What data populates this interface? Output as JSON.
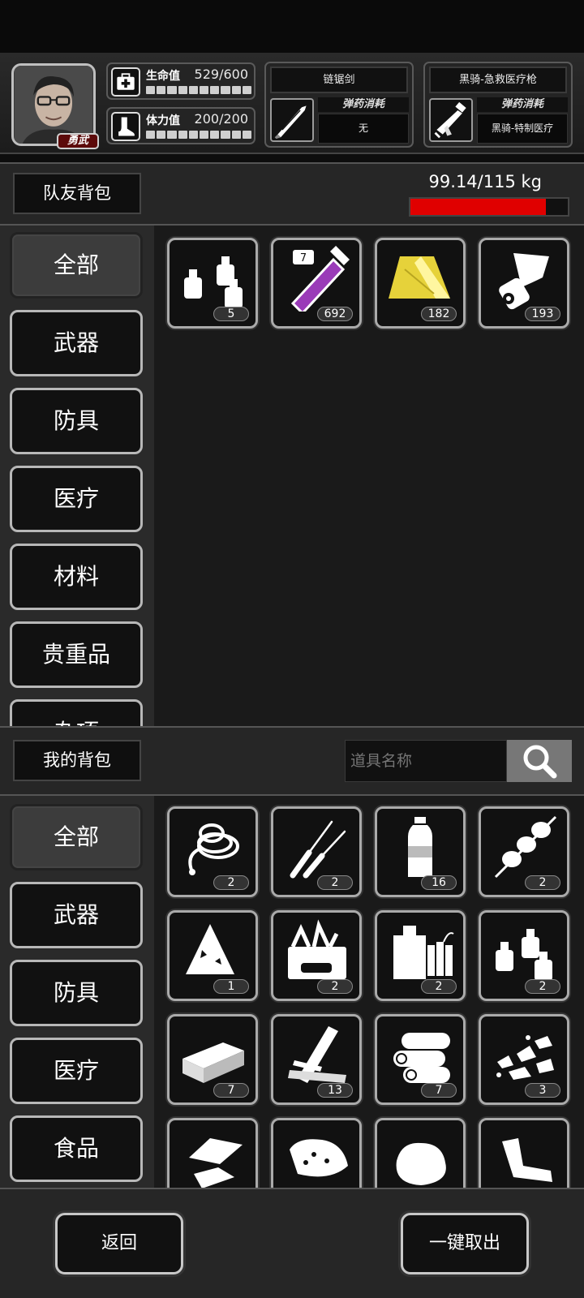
{
  "character": {
    "badge": "勇武"
  },
  "stats": {
    "hp": {
      "label": "生命值",
      "value": "529/600",
      "icon": "first-aid-kit-icon"
    },
    "stamina": {
      "label": "体力值",
      "value": "200/200",
      "icon": "boot-icon"
    }
  },
  "equipment": [
    {
      "name": "链锯剑",
      "ammo_label": "弹药消耗",
      "ammo_value": "无",
      "icon": "chainsaw-sword-icon"
    },
    {
      "name": "黑骑-急救医疗枪",
      "ammo_label": "弹药消耗",
      "ammo_value": "黑骑-特制医疗",
      "icon": "medic-gun-icon"
    }
  ],
  "team_bag": {
    "title": "队友背包",
    "weight": "99.14/115 kg",
    "weight_fraction": 0.862,
    "weight_color": "#e00000",
    "categories": [
      "全部",
      "武器",
      "防具",
      "医疗",
      "材料",
      "贵重品",
      "杂项"
    ],
    "items": [
      {
        "icon": "bottles-icon",
        "count": "5"
      },
      {
        "icon": "serum-vial-icon",
        "count": "692"
      },
      {
        "icon": "cloth-icon",
        "count": "182"
      },
      {
        "icon": "paper-roll-icon",
        "count": "193"
      }
    ]
  },
  "my_bag": {
    "title": "我的背包",
    "search_placeholder": "道具名称",
    "categories": [
      "全部",
      "武器",
      "防具",
      "医疗",
      "食品"
    ],
    "items": [
      {
        "icon": "rope-icon",
        "count": "2"
      },
      {
        "icon": "lockpicks-icon",
        "count": "2"
      },
      {
        "icon": "water-bottle-icon",
        "count": "16"
      },
      {
        "icon": "meat-skewer-icon",
        "count": "2"
      },
      {
        "icon": "rag-icon",
        "count": "1"
      },
      {
        "icon": "toolbox-icon",
        "count": "2"
      },
      {
        "icon": "dynamite-jerrycan-icon",
        "count": "2"
      },
      {
        "icon": "bottles-icon",
        "count": "2"
      },
      {
        "icon": "brick-icon",
        "count": "7"
      },
      {
        "icon": "planks-icon",
        "count": "13"
      },
      {
        "icon": "logs-icon",
        "count": "7"
      },
      {
        "icon": "rubble-icon",
        "count": "3"
      },
      {
        "icon": "metal-scrap-icon",
        "count": ""
      },
      {
        "icon": "ore-sack-icon",
        "count": ""
      },
      {
        "icon": "fabric-pile-icon",
        "count": ""
      },
      {
        "icon": "bent-pipe-icon",
        "count": ""
      }
    ]
  },
  "footer": {
    "back": "返回",
    "take_all": "一键取出"
  }
}
